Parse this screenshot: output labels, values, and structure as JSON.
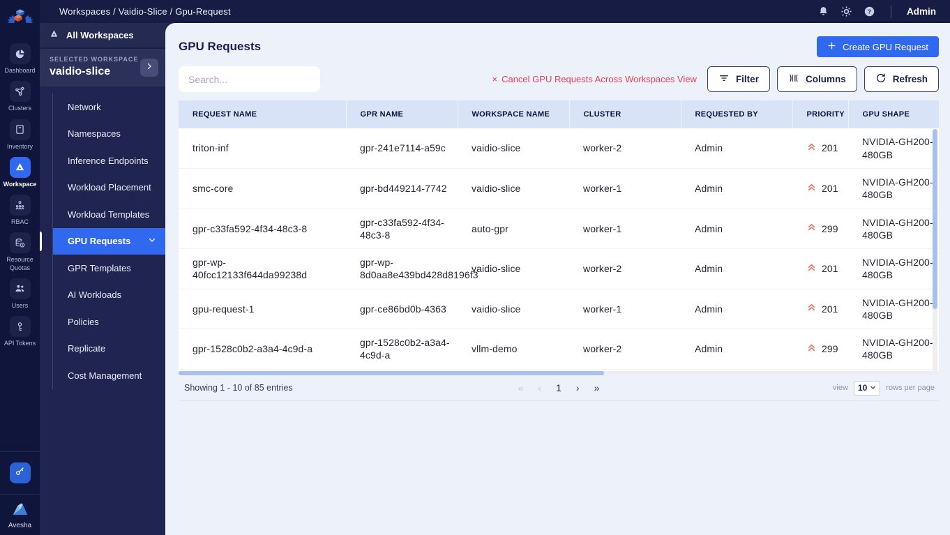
{
  "topbar": {
    "breadcrumb": "Workspaces / Vaidio-Slice / Gpu-Request",
    "user": "Admin"
  },
  "rail": {
    "items": [
      {
        "label": "Dashboard",
        "icon": "dashboard-icon",
        "selected": false
      },
      {
        "label": "Clusters",
        "icon": "clusters-icon",
        "selected": false
      },
      {
        "label": "Inventory",
        "icon": "inventory-icon",
        "selected": false
      },
      {
        "label": "Workspace",
        "icon": "workspace-icon",
        "selected": true
      },
      {
        "label": "RBAC",
        "icon": "rbac-icon",
        "selected": false
      },
      {
        "label": "Resource Quotas",
        "icon": "resource-quotas-icon",
        "selected": false
      },
      {
        "label": "Users",
        "icon": "users-icon",
        "selected": false
      },
      {
        "label": "API Tokens",
        "icon": "api-tokens-icon",
        "selected": false
      }
    ],
    "brand": "Avesha"
  },
  "sidebar": {
    "all_workspaces_label": "All Workspaces",
    "selected_workspace_label": "SELECTED WORKSPACE",
    "selected_workspace_name": "vaidio-slice",
    "items": [
      {
        "label": "Network",
        "selected": false
      },
      {
        "label": "Namespaces",
        "selected": false
      },
      {
        "label": "Inference Endpoints",
        "selected": false
      },
      {
        "label": "Workload Placement",
        "selected": false
      },
      {
        "label": "Workload Templates",
        "selected": false
      },
      {
        "label": "GPU Requests",
        "selected": true
      },
      {
        "label": "GPR Templates",
        "selected": false
      },
      {
        "label": "AI Workloads",
        "selected": false
      },
      {
        "label": "Policies",
        "selected": false
      },
      {
        "label": "Replicate",
        "selected": false
      },
      {
        "label": "Cost Management",
        "selected": false
      }
    ]
  },
  "main": {
    "title": "GPU Requests",
    "create_button_label": "Create GPU Request",
    "search_placeholder": "Search...",
    "cancel_link_label": "Cancel GPU Requests Across Workspaces View",
    "cancel_x": "×",
    "filter_button_label": "Filter",
    "columns_button_label": "Columns",
    "refresh_button_label": "Refresh"
  },
  "table": {
    "columns": [
      "REQUEST NAME",
      "GPR NAME",
      "WORKSPACE NAME",
      "CLUSTER",
      "REQUESTED BY",
      "PRIORITY",
      "GPU SHAPE"
    ],
    "rows": [
      {
        "request_name": "triton-inf",
        "gpr_name": "gpr-241e7114-a59c",
        "workspace_name": "vaidio-slice",
        "cluster": "worker-2",
        "requested_by": "Admin",
        "priority": "201",
        "gpu_shape": "NVIDIA-GH200-480GB"
      },
      {
        "request_name": "smc-core",
        "gpr_name": "gpr-bd449214-7742",
        "workspace_name": "vaidio-slice",
        "cluster": "worker-1",
        "requested_by": "Admin",
        "priority": "201",
        "gpu_shape": "NVIDIA-GH200-480GB"
      },
      {
        "request_name": "gpr-c33fa592-4f34-48c3-8",
        "gpr_name": "gpr-c33fa592-4f34-48c3-8",
        "workspace_name": "auto-gpr",
        "cluster": "worker-1",
        "requested_by": "Admin",
        "priority": "299",
        "gpu_shape": "NVIDIA-GH200-480GB"
      },
      {
        "request_name": "gpr-wp-40fcc12133f644da99238d",
        "gpr_name": "gpr-wp-8d0aa8e439bd428d8196f3",
        "workspace_name": "vaidio-slice",
        "cluster": "worker-2",
        "requested_by": "Admin",
        "priority": "201",
        "gpu_shape": "NVIDIA-GH200-480GB"
      },
      {
        "request_name": "gpu-request-1",
        "gpr_name": "gpr-ce86bd0b-4363",
        "workspace_name": "vaidio-slice",
        "cluster": "worker-1",
        "requested_by": "Admin",
        "priority": "201",
        "gpu_shape": "NVIDIA-GH200-480GB"
      },
      {
        "request_name": "gpr-1528c0b2-a3a4-4c9d-a",
        "gpr_name": "gpr-1528c0b2-a3a4-4c9d-a",
        "workspace_name": "vllm-demo",
        "cluster": "worker-2",
        "requested_by": "Admin",
        "priority": "299",
        "gpu_shape": "NVIDIA-GH200-480GB"
      }
    ]
  },
  "footer": {
    "showing_text": "Showing 1 - 10 of 85 entries",
    "pagination": {
      "first": "«",
      "prev": "‹",
      "page": "1",
      "next": "›",
      "last": "»"
    },
    "view_label": "view",
    "rows_per_page_value": "10",
    "rows_per_page_label": "rows per page"
  },
  "colors": {
    "accent_blue": "#3069f0",
    "danger_red": "#e94056",
    "priority_salmon": "#ed7161",
    "topbar_navy": "#171c45",
    "sidebar_navy": "#1f2550",
    "table_header_blue": "#d9e3f8"
  }
}
